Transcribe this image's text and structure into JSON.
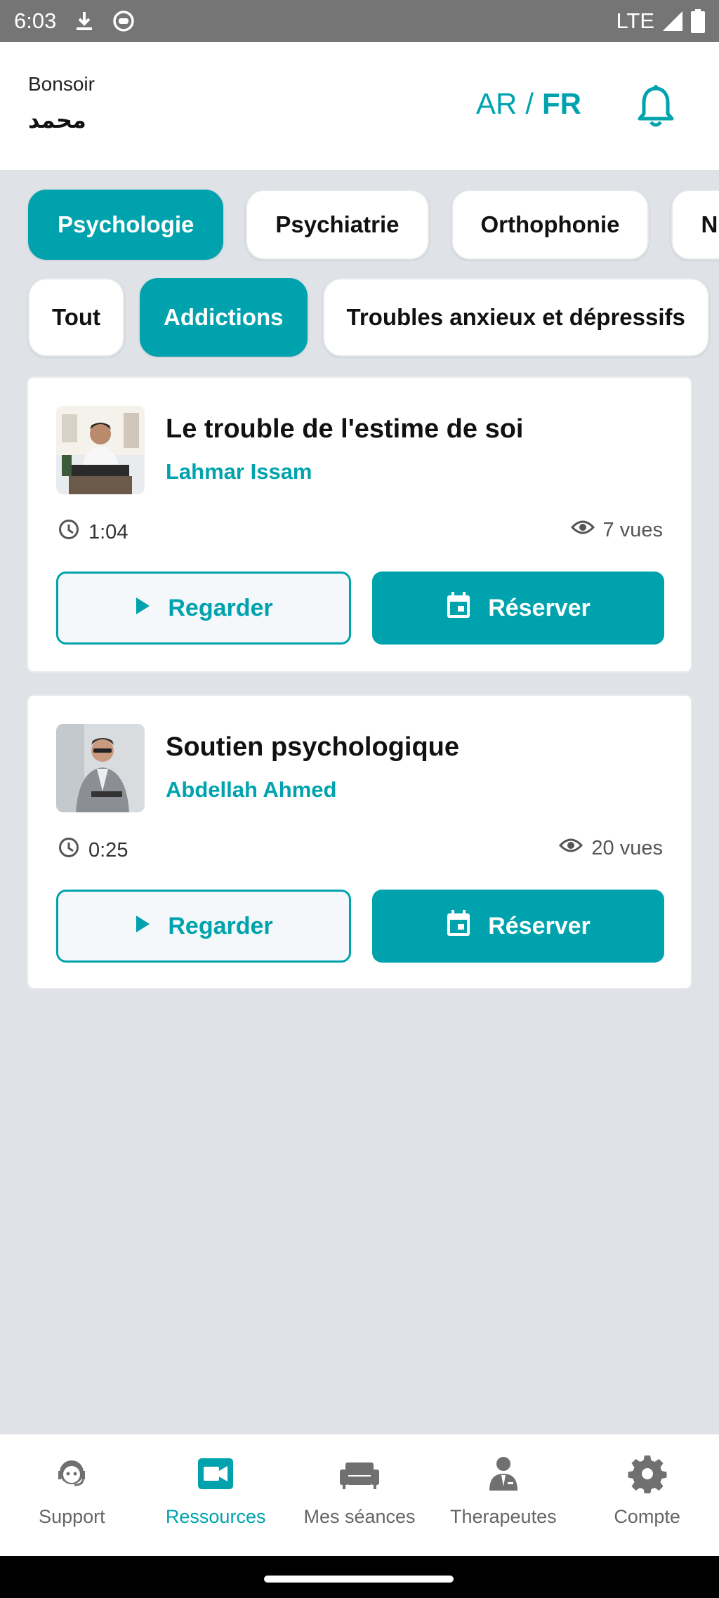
{
  "status_bar": {
    "time": "6:03",
    "network": "LTE"
  },
  "header": {
    "greeting": "Bonsoir",
    "user_name": "محمد",
    "lang_ar": "AR",
    "lang_sep": "/",
    "lang_fr": "FR"
  },
  "categories": [
    {
      "label": "Psychologie",
      "active": true
    },
    {
      "label": "Psychiatrie",
      "active": false
    },
    {
      "label": "Orthophonie",
      "active": false
    },
    {
      "label": "Nu",
      "active": false
    }
  ],
  "subcategories": [
    {
      "label": "Tout",
      "active": false
    },
    {
      "label": "Addictions",
      "active": true
    },
    {
      "label": "Troubles anxieux et dépressifs",
      "active": false
    }
  ],
  "videos": [
    {
      "title": "Le trouble de l'estime de soi",
      "therapist": "Lahmar Issam",
      "duration": "1:04",
      "views": "7 vues",
      "watch_label": "Regarder",
      "book_label": "Réserver"
    },
    {
      "title": "Soutien psychologique",
      "therapist": "Abdellah Ahmed",
      "duration": "0:25",
      "views": "20 vues",
      "watch_label": "Regarder",
      "book_label": "Réserver"
    }
  ],
  "bottom_nav": [
    {
      "label": "Support",
      "icon": "support-agent-icon",
      "active": false
    },
    {
      "label": "Ressources",
      "icon": "video-camera-icon",
      "active": true
    },
    {
      "label": "Mes séances",
      "icon": "sofa-icon",
      "active": false
    },
    {
      "label": "Therapeutes",
      "icon": "therapist-icon",
      "active": false
    },
    {
      "label": "Compte",
      "icon": "gear-icon",
      "active": false
    }
  ],
  "colors": {
    "accent": "#00a3ad",
    "background": "#dfe2e6",
    "status_bar": "#757575"
  }
}
